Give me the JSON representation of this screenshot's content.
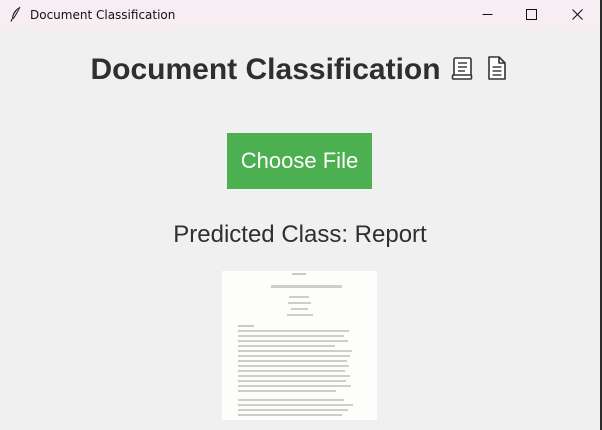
{
  "window": {
    "title": "Document Classification",
    "controls": [
      "minimize-icon",
      "maximize-icon",
      "close-icon"
    ]
  },
  "main": {
    "heading": "Document Classification",
    "heading_icons": [
      "ledger-icon",
      "document-icon"
    ],
    "choose_file_label": "Choose File",
    "predicted_label": "Predicted Class: Report"
  },
  "colors": {
    "button_bg": "#4caf50",
    "button_text": "#ffffff",
    "window_bg": "#f0f0f0",
    "title_bar_bg": "#f6eef3"
  },
  "preview": {
    "description": "scanned document thumbnail"
  }
}
